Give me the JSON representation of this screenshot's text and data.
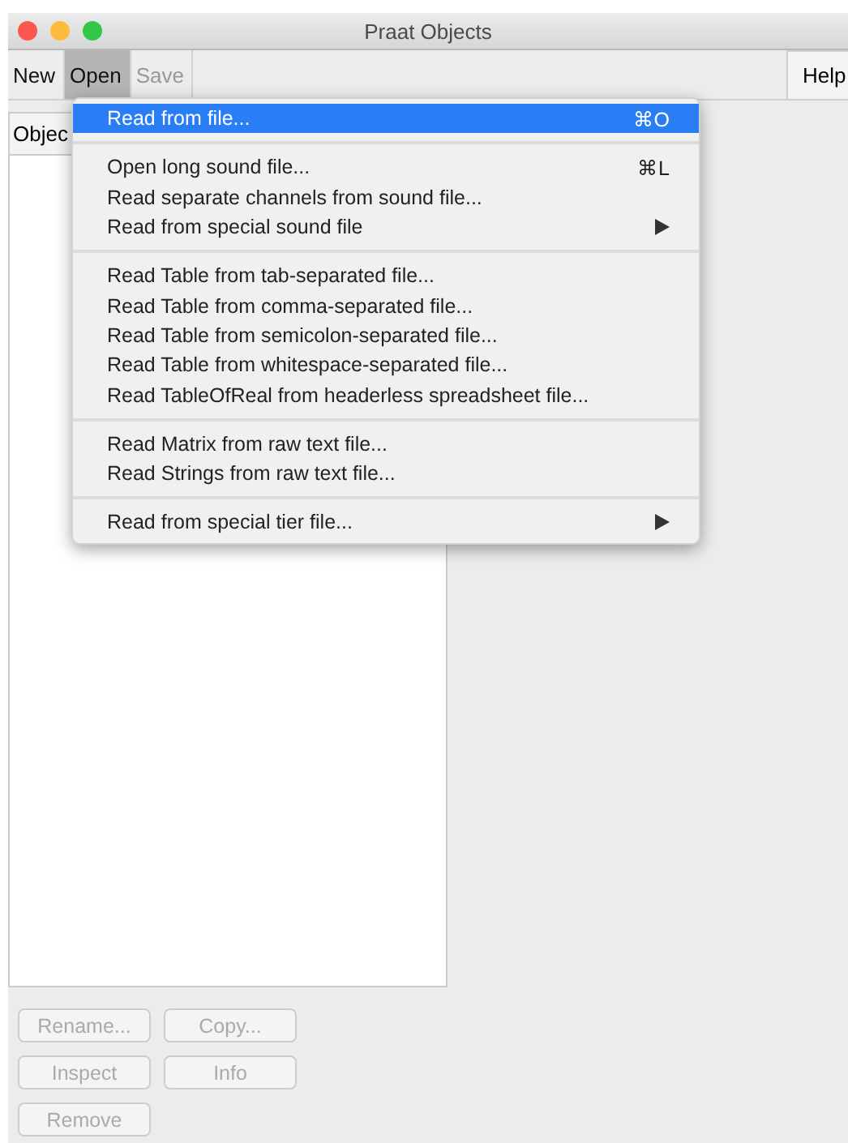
{
  "window": {
    "title": "Praat Objects"
  },
  "menubar": [
    {
      "label": "New",
      "selected": false,
      "disabled": false
    },
    {
      "label": "Open",
      "selected": true,
      "disabled": false
    },
    {
      "label": "Save",
      "selected": false,
      "disabled": true
    }
  ],
  "help_button": {
    "label": "Help"
  },
  "objects_list": {
    "header": "Objec"
  },
  "open_menu": {
    "groups": [
      [
        {
          "label": "Read from file...",
          "shortcut": "⌘O",
          "submenu": false,
          "selected": true
        }
      ],
      [
        {
          "label": "Open long sound file...",
          "shortcut": "⌘L",
          "submenu": false,
          "selected": false
        },
        {
          "label": "Read separate channels from sound file...",
          "submenu": false,
          "selected": false
        },
        {
          "label": "Read from special sound file",
          "submenu": true,
          "selected": false
        }
      ],
      [
        {
          "label": "Read Table from tab-separated file...",
          "submenu": false,
          "selected": false
        },
        {
          "label": "Read Table from comma-separated file...",
          "submenu": false,
          "selected": false
        },
        {
          "label": "Read Table from semicolon-separated file...",
          "submenu": false,
          "selected": false
        },
        {
          "label": "Read Table from whitespace-separated file...",
          "submenu": false,
          "selected": false
        },
        {
          "label": "Read TableOfReal from headerless spreadsheet file...",
          "submenu": false,
          "selected": false
        }
      ],
      [
        {
          "label": "Read Matrix from raw text file...",
          "submenu": false,
          "selected": false
        },
        {
          "label": "Read Strings from raw text file...",
          "submenu": false,
          "selected": false
        }
      ],
      [
        {
          "label": "Read from special tier file...",
          "submenu": true,
          "selected": false
        }
      ]
    ]
  },
  "object_buttons": [
    [
      {
        "label": "Rename...",
        "disabled": true
      },
      {
        "label": "Copy...",
        "disabled": true
      }
    ],
    [
      {
        "label": "Inspect",
        "disabled": true
      },
      {
        "label": "Info",
        "disabled": true
      }
    ],
    [
      {
        "label": "Remove",
        "disabled": true
      }
    ]
  ]
}
